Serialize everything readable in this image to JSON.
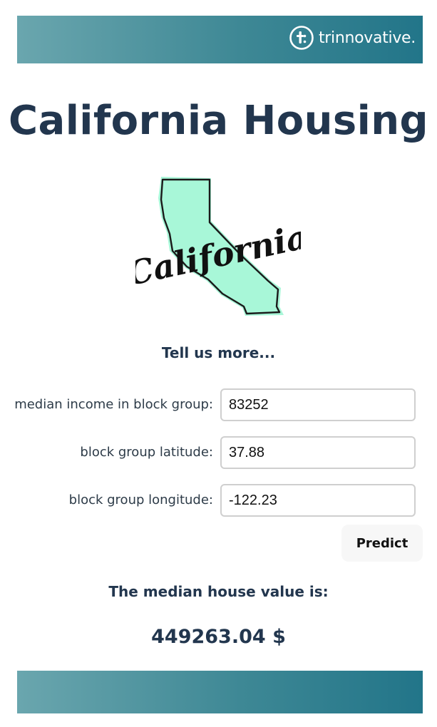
{
  "header": {
    "brand_name": "trinnovative.",
    "brand_icon": "trinnovative-logo-icon"
  },
  "page": {
    "title": "California Housing",
    "logo_image": "california-map-logo",
    "logo_text": "California",
    "subheading": "Tell us more..."
  },
  "form": {
    "fields": [
      {
        "label": "median income in block group:",
        "value": "83252"
      },
      {
        "label": "block group latitude:",
        "value": "37.88"
      },
      {
        "label": "block group longitude:",
        "value": "-122.23"
      }
    ],
    "predict_label": "Predict"
  },
  "result": {
    "label": "The median house value is:",
    "value": "449263.04 $"
  },
  "colors": {
    "banner_start": "#6aa6ae",
    "banner_end": "#227589",
    "heading": "#22364e",
    "map_fill": "#a8f7d8"
  }
}
